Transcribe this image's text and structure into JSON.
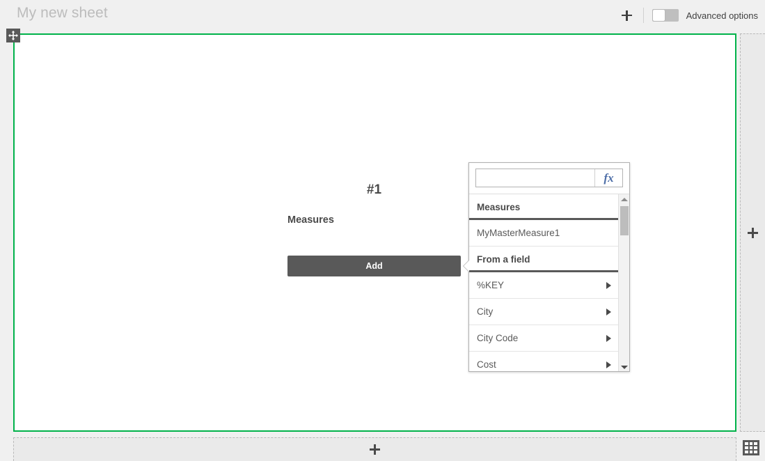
{
  "topbar": {
    "sheet_title": "My new sheet",
    "add_icon": "plus-icon",
    "advanced_options_label": "Advanced options",
    "advanced_options_state": "off"
  },
  "canvas": {
    "border_color": "#00b24a",
    "move_handle_icon": "move-arrows-icon"
  },
  "object": {
    "number_label": "#1",
    "section_label": "Measures",
    "add_button_label": "Add"
  },
  "popover": {
    "search": {
      "value": "",
      "placeholder": ""
    },
    "expression_button_label": "fx",
    "sections": [
      {
        "header": "Measures",
        "items": [
          {
            "label": "MyMasterMeasure1",
            "has_caret": false
          }
        ]
      },
      {
        "header": "From a field",
        "items": [
          {
            "label": "%KEY",
            "has_caret": true
          },
          {
            "label": "City",
            "has_caret": true
          },
          {
            "label": "City Code",
            "has_caret": true
          },
          {
            "label": "Cost",
            "has_caret": true
          }
        ]
      }
    ],
    "scrollbar": {
      "up_icon": "triangle-up-icon",
      "down_icon": "triangle-down-icon"
    }
  },
  "dropzones": {
    "right_icon": "plus-icon",
    "bottom_icon": "plus-icon"
  },
  "footer": {
    "grid_icon": "grid-view-icon"
  }
}
